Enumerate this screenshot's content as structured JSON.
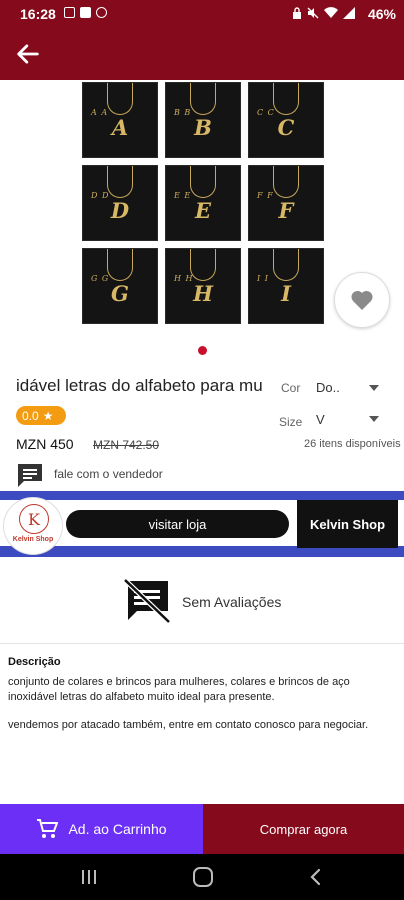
{
  "status_bar": {
    "time": "16:28",
    "battery": "46%"
  },
  "product": {
    "image_letters": [
      {
        "big": "A",
        "small": "A A"
      },
      {
        "big": "B",
        "small": "B B"
      },
      {
        "big": "C",
        "small": "C C"
      },
      {
        "big": "D",
        "small": "D D"
      },
      {
        "big": "E",
        "small": "E E"
      },
      {
        "big": "F",
        "small": "F F"
      },
      {
        "big": "G",
        "small": "G G"
      },
      {
        "big": "H",
        "small": "H H"
      },
      {
        "big": "I",
        "small": "I I"
      }
    ],
    "title": "idável letras do alfabeto para mu",
    "rating": "0.0",
    "price": "MZN 450",
    "old_price": "MZN 742.50",
    "color_label": "Cor",
    "color_value": "Do..",
    "size_label": "Size",
    "size_value": "V",
    "stock": "26 itens disponíveis",
    "chat_label": "fale com o vendedor"
  },
  "shop": {
    "logo_letter": "K",
    "logo_text": "Kelvin Shop",
    "visit_label": "visitar loja",
    "name": "Kelvin Shop"
  },
  "reviews": {
    "empty_label": "Sem Avaliações"
  },
  "description": {
    "heading": "Descrição",
    "paragraph1": "conjunto de colares e brincos para mulheres, colares e brincos de aço inoxidável letras do alfabeto muito ideal para presente.",
    "paragraph2": "vendemos por atacado também, entre em contato conosco para negociar."
  },
  "actions": {
    "add_to_cart": "Ad. ao Carrinho",
    "buy_now": "Comprar agora"
  },
  "colors": {
    "brand": "#850b1c",
    "cart": "#6b2ff6",
    "shop_band": "#3d4bc0",
    "rating": "#f39c12"
  }
}
